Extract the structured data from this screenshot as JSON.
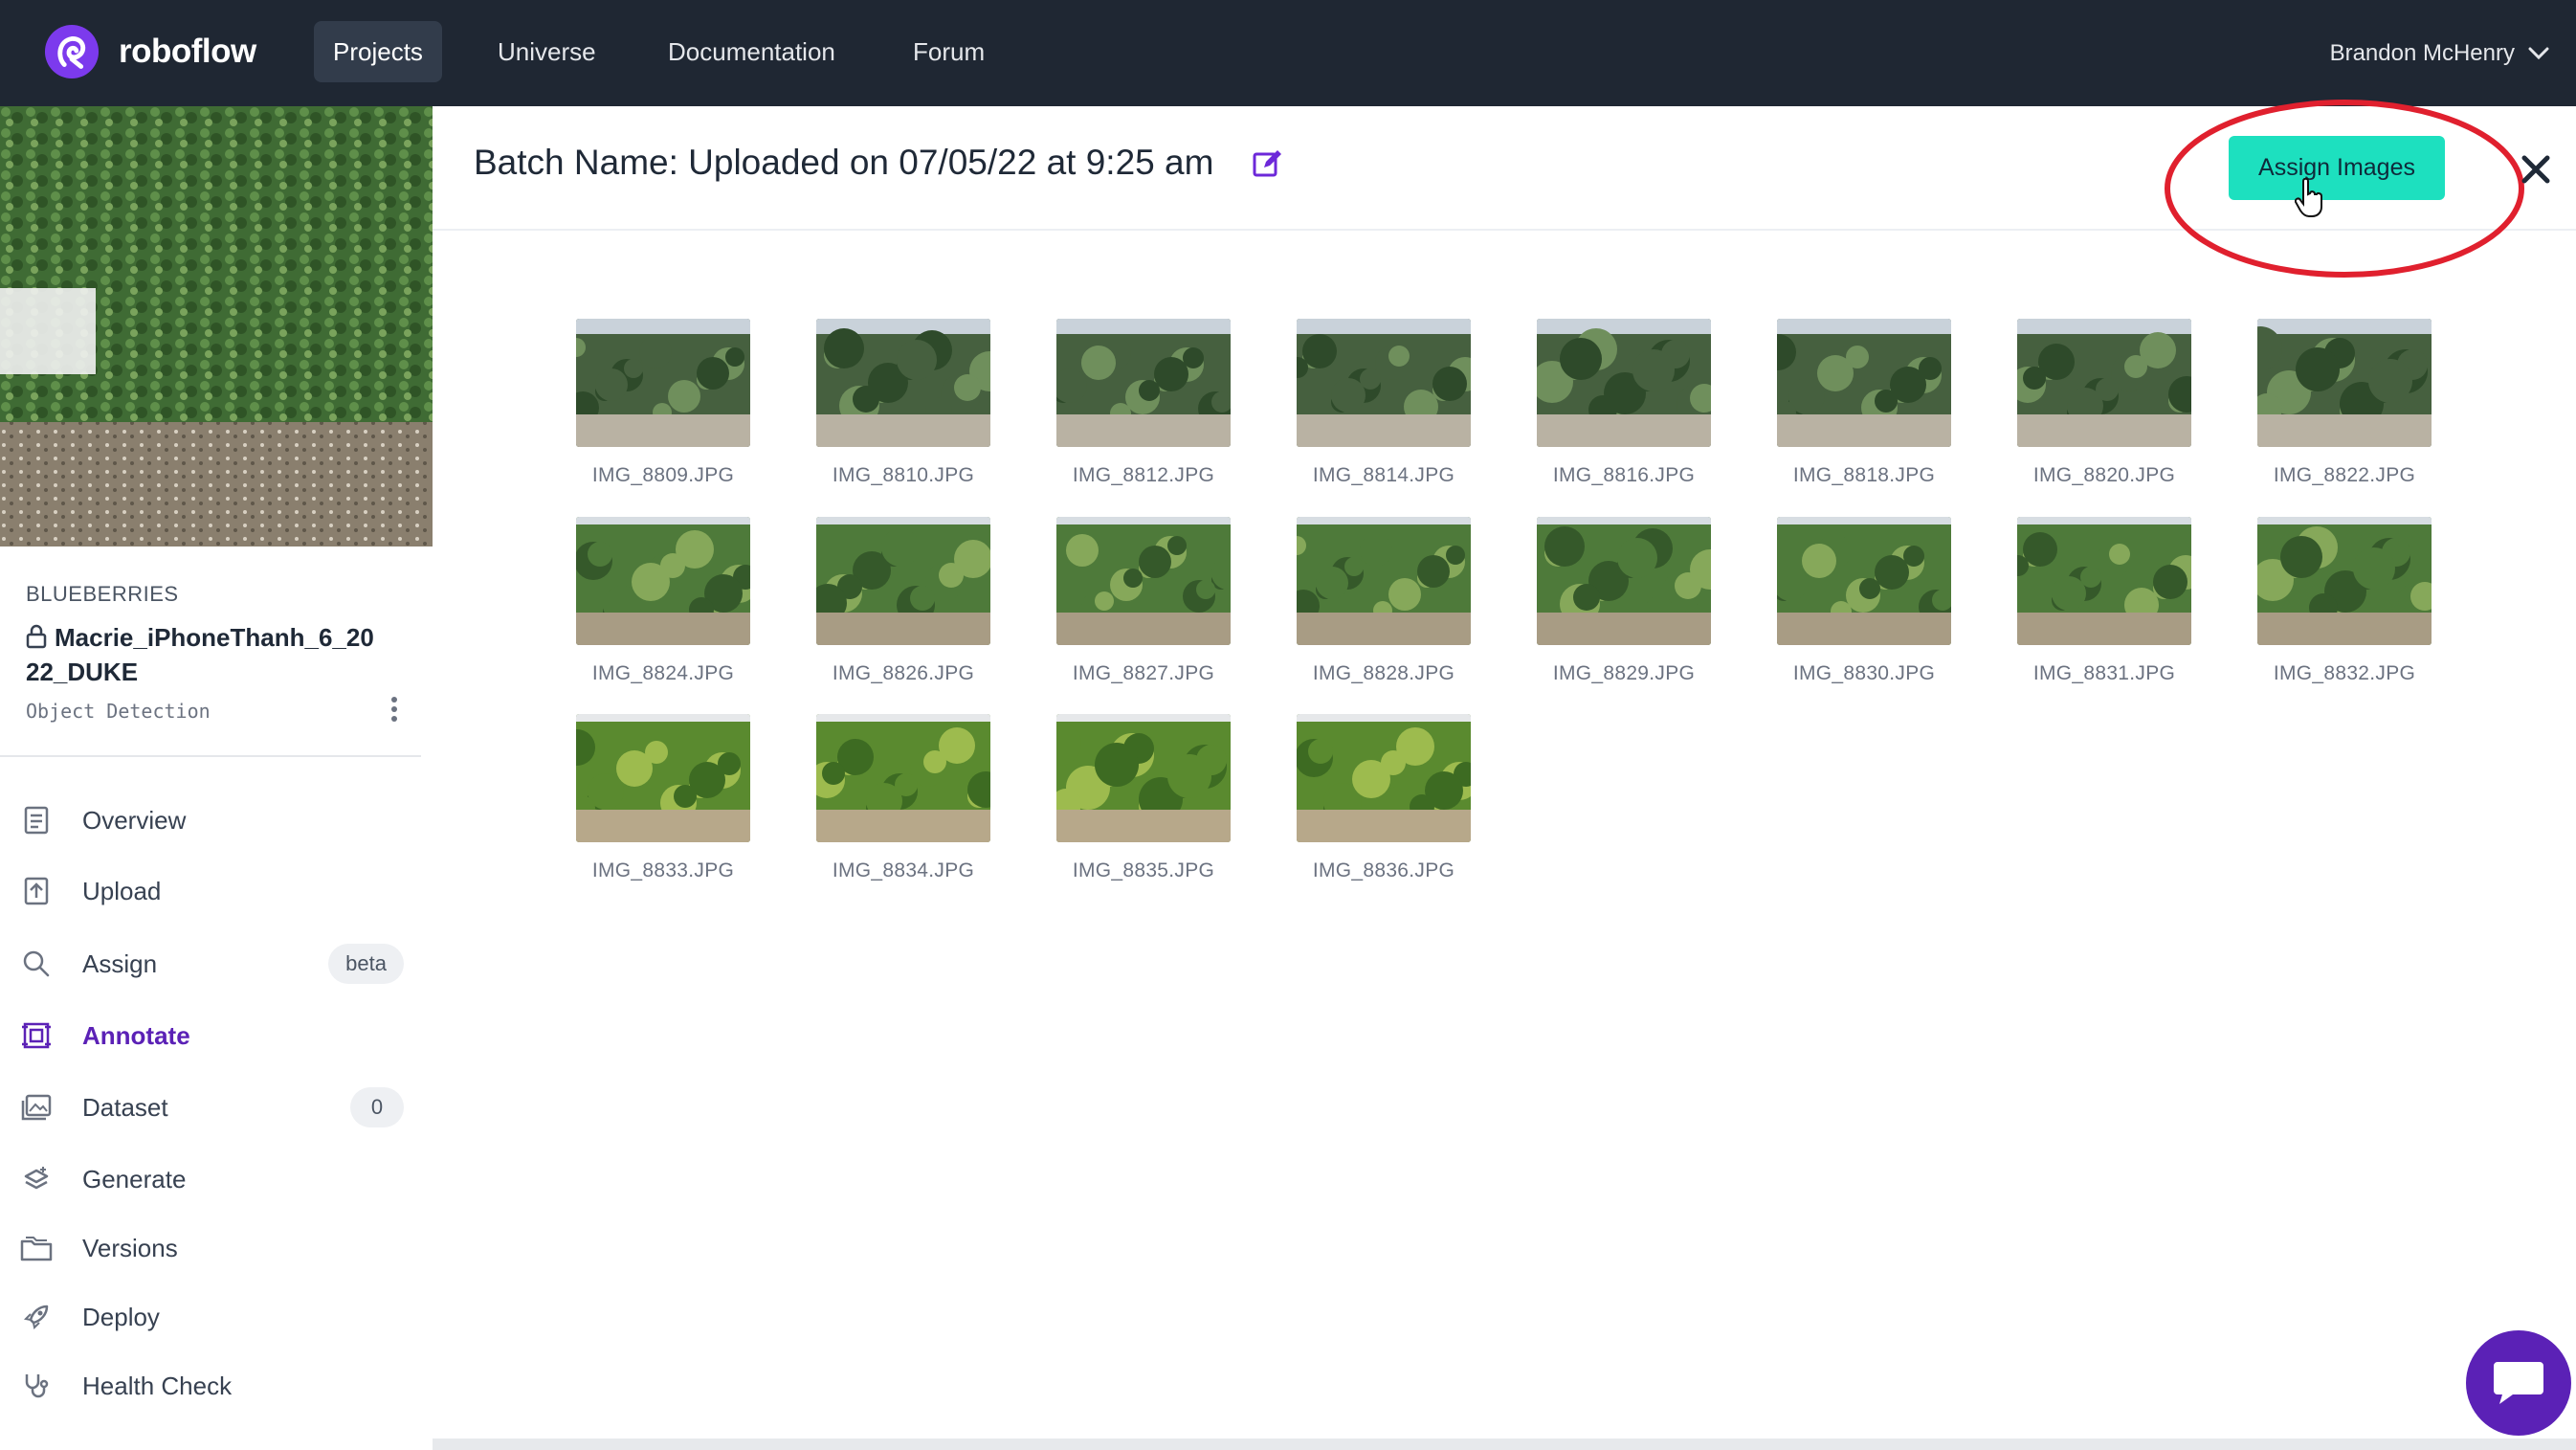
{
  "nav": {
    "brand": "roboflow",
    "links": [
      "Projects",
      "Universe",
      "Documentation",
      "Forum"
    ],
    "active": "Projects",
    "user": "Brandon McHenry"
  },
  "project": {
    "group": "BLUEBERRIES",
    "name": "Macrie_iPhoneThanh_6_2022_DUKE",
    "type": "Object Detection"
  },
  "sidebar": {
    "items": [
      {
        "label": "Overview",
        "icon": "overview-icon"
      },
      {
        "label": "Upload",
        "icon": "upload-icon"
      },
      {
        "label": "Assign",
        "icon": "search-icon",
        "badge": "beta"
      },
      {
        "label": "Annotate",
        "icon": "annotate-icon",
        "active": true
      },
      {
        "label": "Dataset",
        "icon": "dataset-icon",
        "badge": "0"
      },
      {
        "label": "Generate",
        "icon": "generate-icon"
      },
      {
        "label": "Versions",
        "icon": "versions-icon"
      },
      {
        "label": "Deploy",
        "icon": "rocket-icon"
      },
      {
        "label": "Health Check",
        "icon": "stethoscope-icon"
      }
    ]
  },
  "batch": {
    "title": "Batch Name: Uploaded on 07/05/22 at 9:25 am",
    "assign_label": "Assign Images"
  },
  "images": [
    "IMG_8809.JPG",
    "IMG_8810.JPG",
    "IMG_8812.JPG",
    "IMG_8814.JPG",
    "IMG_8816.JPG",
    "IMG_8818.JPG",
    "IMG_8820.JPG",
    "IMG_8822.JPG",
    "IMG_8824.JPG",
    "IMG_8826.JPG",
    "IMG_8827.JPG",
    "IMG_8828.JPG",
    "IMG_8829.JPG",
    "IMG_8830.JPG",
    "IMG_8831.JPG",
    "IMG_8832.JPG",
    "IMG_8833.JPG",
    "IMG_8834.JPG",
    "IMG_8835.JPG",
    "IMG_8836.JPG"
  ],
  "colors": {
    "nav_bg": "#1f2733",
    "accent_teal": "#1de0bf",
    "brand_purple": "#5b21b6",
    "annotation_red": "#e0202e"
  }
}
